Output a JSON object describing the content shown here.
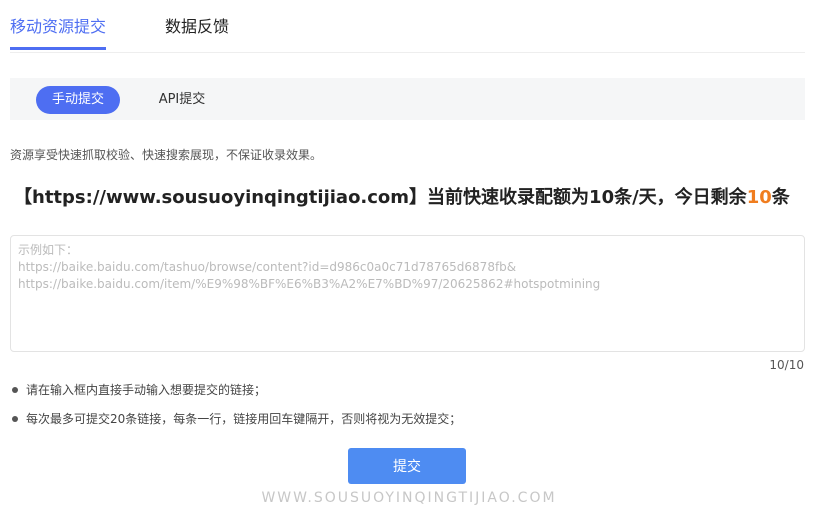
{
  "tabs": {
    "active": "移动资源提交",
    "inactive": "数据反馈"
  },
  "subtabs": {
    "manual": "手动提交",
    "api": "API提交"
  },
  "description": "资源享受快速抓取校验、快速搜索展现，不保证收录效果。",
  "quota": {
    "prefix": "【https://www.sousuoyinqingtijiao.com】当前快速收录配额为10条/天，今日剩余",
    "remaining": "10",
    "suffix": "条"
  },
  "input": {
    "value": "",
    "placeholder": "示例如下：\nhttps://baike.baidu.com/tashuo/browse/content?id=d986c0a0c71d78765d6878fb&\nhttps://baike.baidu.com/item/%E9%98%BF%E6%B3%A2%E7%BD%97/20625862#hotspotmining"
  },
  "counter": "10/10",
  "tips": [
    "请在输入框内直接手动输入想要提交的链接；",
    "每次最多可提交20条链接，每条一行，链接用回车键隔开，否则将视为无效提交；"
  ],
  "submit_label": "提交",
  "watermark": "WWW.SOUSUOYINQINGTIJIAO.COM",
  "colors": {
    "accent": "#4e6ef2",
    "button": "#4e8cf2",
    "highlight": "#f07d1f"
  }
}
